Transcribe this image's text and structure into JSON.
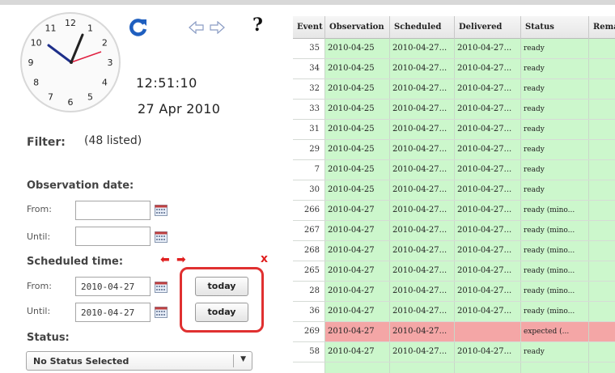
{
  "clock": {
    "numerals": [
      "12",
      "1",
      "2",
      "3",
      "4",
      "5",
      "6",
      "7",
      "8",
      "9",
      "10",
      "11"
    ],
    "time": "12:51:10",
    "date": "27 Apr 2010"
  },
  "toolbar": {
    "refresh_icon": "refresh-icon",
    "back_icon": "arrow-left-icon",
    "forward_icon": "arrow-right-icon",
    "help_label": "?"
  },
  "filter": {
    "label": "Filter:",
    "count": "(48 listed)",
    "observation": {
      "title": "Observation date:",
      "from_label": "From:",
      "until_label": "Until:",
      "from_value": "",
      "until_value": ""
    },
    "scheduled": {
      "title": "Scheduled time:",
      "from_label": "From:",
      "until_label": "Until:",
      "from_value": "2010-04-27",
      "until_value": "2010-04-27",
      "today_label": "today",
      "clear_label": "x"
    },
    "status": {
      "title": "Status:",
      "selected": "No Status Selected"
    }
  },
  "table": {
    "headers": [
      "Event",
      "Observation",
      "Scheduled",
      "Delivered",
      "Status",
      "Remarks"
    ],
    "rows": [
      {
        "event": "35",
        "observation": "2010-04-25",
        "scheduled": "2010-04-27...",
        "delivered": "2010-04-27...",
        "status": "ready",
        "state": "ok"
      },
      {
        "event": "34",
        "observation": "2010-04-25",
        "scheduled": "2010-04-27...",
        "delivered": "2010-04-27...",
        "status": "ready",
        "state": "ok"
      },
      {
        "event": "32",
        "observation": "2010-04-25",
        "scheduled": "2010-04-27...",
        "delivered": "2010-04-27...",
        "status": "ready",
        "state": "ok"
      },
      {
        "event": "33",
        "observation": "2010-04-25",
        "scheduled": "2010-04-27...",
        "delivered": "2010-04-27...",
        "status": "ready",
        "state": "ok"
      },
      {
        "event": "31",
        "observation": "2010-04-25",
        "scheduled": "2010-04-27...",
        "delivered": "2010-04-27...",
        "status": "ready",
        "state": "ok"
      },
      {
        "event": "29",
        "observation": "2010-04-25",
        "scheduled": "2010-04-27...",
        "delivered": "2010-04-27...",
        "status": "ready",
        "state": "ok"
      },
      {
        "event": "7",
        "observation": "2010-04-25",
        "scheduled": "2010-04-27...",
        "delivered": "2010-04-27...",
        "status": "ready",
        "state": "ok"
      },
      {
        "event": "30",
        "observation": "2010-04-25",
        "scheduled": "2010-04-27...",
        "delivered": "2010-04-27...",
        "status": "ready",
        "state": "ok"
      },
      {
        "event": "266",
        "observation": "2010-04-27",
        "scheduled": "2010-04-27...",
        "delivered": "2010-04-27...",
        "status": "ready (mino...",
        "state": "ok"
      },
      {
        "event": "267",
        "observation": "2010-04-27",
        "scheduled": "2010-04-27...",
        "delivered": "2010-04-27...",
        "status": "ready (mino...",
        "state": "ok"
      },
      {
        "event": "268",
        "observation": "2010-04-27",
        "scheduled": "2010-04-27...",
        "delivered": "2010-04-27...",
        "status": "ready (mino...",
        "state": "ok"
      },
      {
        "event": "265",
        "observation": "2010-04-27",
        "scheduled": "2010-04-27...",
        "delivered": "2010-04-27...",
        "status": "ready (mino...",
        "state": "ok"
      },
      {
        "event": "28",
        "observation": "2010-04-27",
        "scheduled": "2010-04-27...",
        "delivered": "2010-04-27...",
        "status": "ready (mino...",
        "state": "ok"
      },
      {
        "event": "36",
        "observation": "2010-04-27",
        "scheduled": "2010-04-27...",
        "delivered": "2010-04-27...",
        "status": "ready (mino...",
        "state": "ok"
      },
      {
        "event": "269",
        "observation": "2010-04-27",
        "scheduled": "2010-04-27...",
        "delivered": "",
        "status": "expected (...",
        "state": "err"
      },
      {
        "event": "58",
        "observation": "2010-04-27",
        "scheduled": "2010-04-27...",
        "delivered": "2010-04-27...",
        "status": "ready",
        "state": "ok"
      },
      {
        "event": "",
        "observation": "",
        "scheduled": "",
        "delivered": "",
        "status": "",
        "state": "ok"
      }
    ]
  },
  "colors": {
    "ok_row": "#ccf7cc",
    "error_row": "#f4a6a6",
    "accent_blue": "#1f5fbf",
    "highlight_red": "#e03030"
  }
}
